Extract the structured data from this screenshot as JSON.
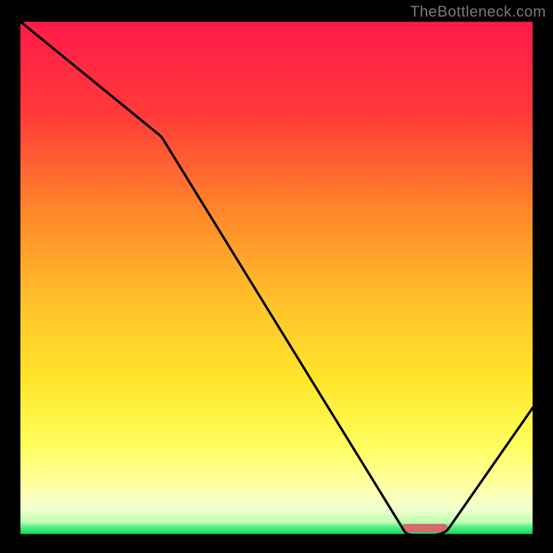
{
  "watermark": "TheBottleneck.com",
  "chart_data": {
    "type": "line",
    "title": "",
    "xlabel": "",
    "ylabel": "",
    "x": [
      0,
      27,
      27.5,
      75,
      80,
      100
    ],
    "y": [
      100,
      78,
      77,
      0,
      0,
      25
    ],
    "marker_x_range": [
      74,
      82
    ],
    "ylim": [
      0,
      100
    ],
    "xlim": [
      0,
      100
    ],
    "background_gradient": {
      "top": "#ff1a4a",
      "mid_upper": "#ff6a2a",
      "middle": "#ffd22a",
      "mid_lower": "#ffff7a",
      "bottom_above_green": "#f5ffcc",
      "green": "#00e05a"
    },
    "marker_color": "#d56a6a",
    "line_color": "#000000",
    "annotations": []
  }
}
